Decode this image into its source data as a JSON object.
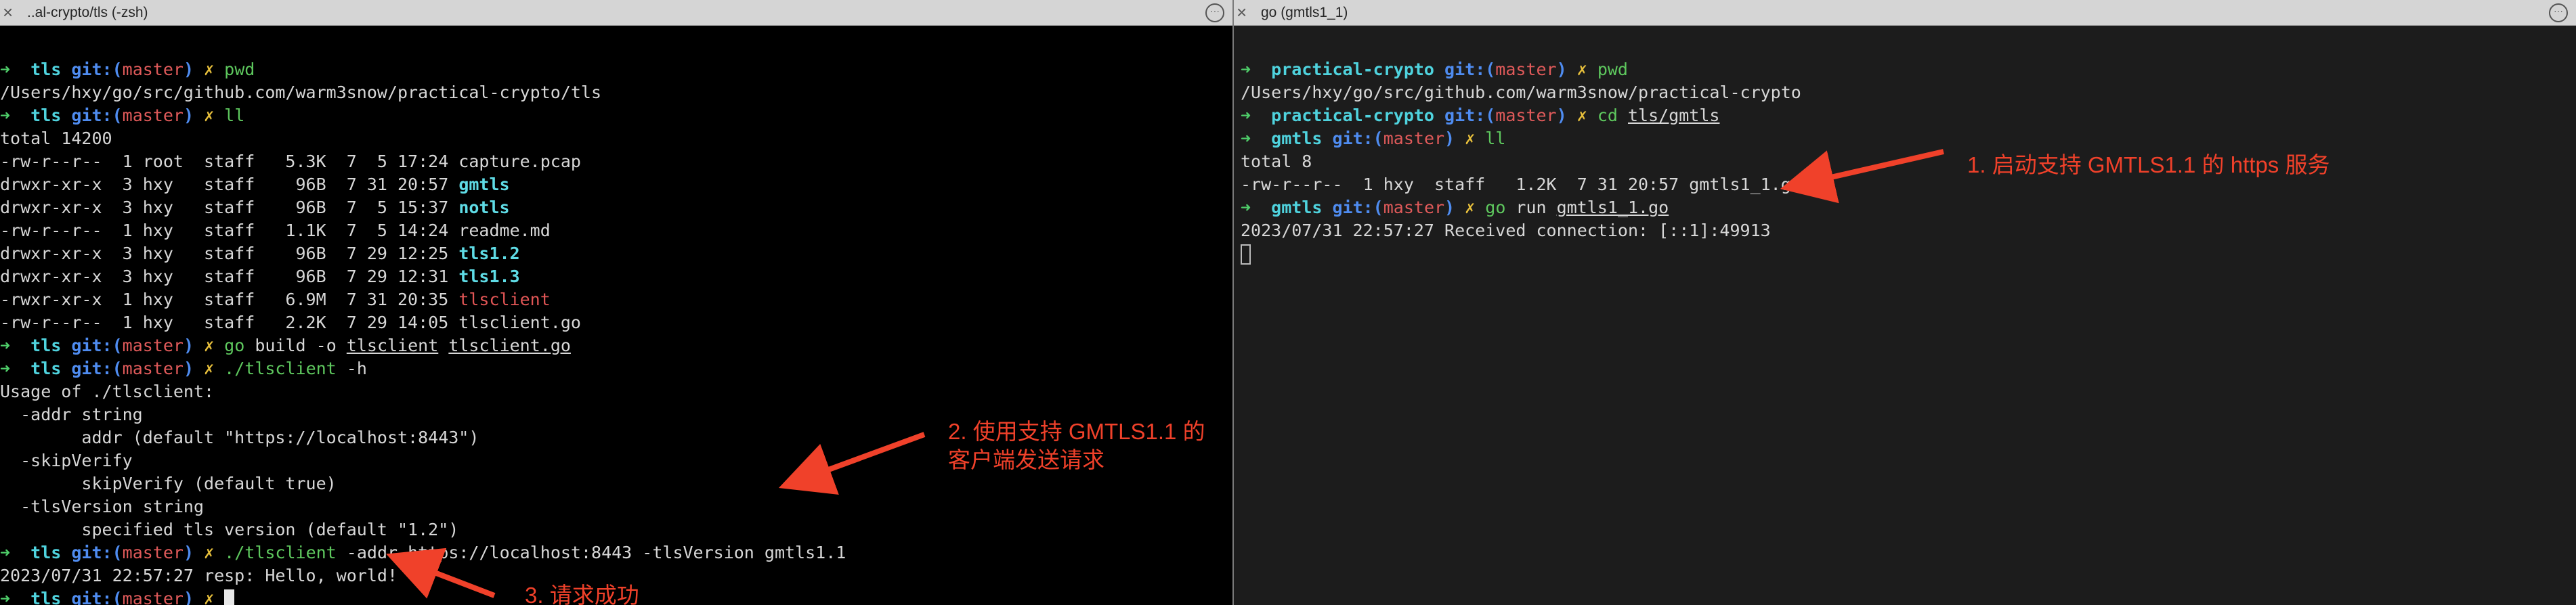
{
  "left_pane": {
    "title": "..al-crypto/tls (-zsh)",
    "lines": [
      [
        {
          "t": "➜ ",
          "c": "arr"
        },
        {
          "t": " tls",
          "c": "dir"
        },
        {
          "t": " git:(",
          "c": "git"
        },
        {
          "t": "master",
          "c": "br"
        },
        {
          "t": ")",
          "c": "git"
        },
        {
          "t": " ✗ ",
          "c": "mark"
        },
        {
          "t": "pwd",
          "c": "cmd"
        }
      ],
      [
        {
          "t": "/Users/hxy/go/src/github.com/warm3snow/practical-crypto/tls",
          "c": ""
        }
      ],
      [
        {
          "t": "➜ ",
          "c": "arr"
        },
        {
          "t": " tls",
          "c": "dir"
        },
        {
          "t": " git:(",
          "c": "git"
        },
        {
          "t": "master",
          "c": "br"
        },
        {
          "t": ")",
          "c": "git"
        },
        {
          "t": " ✗ ",
          "c": "mark"
        },
        {
          "t": "ll",
          "c": "cmd"
        }
      ],
      [
        {
          "t": "total 14200",
          "c": ""
        }
      ],
      [
        {
          "t": "-rw-r--r--  1 root  staff   5.3K  7  5 17:24 capture.pcap",
          "c": ""
        }
      ],
      [
        {
          "t": "drwxr-xr-x  3 hxy   staff    96B  7 31 20:57 ",
          "c": ""
        },
        {
          "t": "gmtls",
          "c": "bold-cyan"
        }
      ],
      [
        {
          "t": "drwxr-xr-x  3 hxy   staff    96B  7  5 15:37 ",
          "c": ""
        },
        {
          "t": "notls",
          "c": "bold-cyan"
        }
      ],
      [
        {
          "t": "-rw-r--r--  1 hxy   staff   1.1K  7  5 14:24 readme.md",
          "c": ""
        }
      ],
      [
        {
          "t": "drwxr-xr-x  3 hxy   staff    96B  7 29 12:25 ",
          "c": ""
        },
        {
          "t": "tls1.2",
          "c": "bold-cyan"
        }
      ],
      [
        {
          "t": "drwxr-xr-x  3 hxy   staff    96B  7 29 12:31 ",
          "c": ""
        },
        {
          "t": "tls1.3",
          "c": "bold-cyan"
        }
      ],
      [
        {
          "t": "-rwxr-xr-x  1 hxy   staff   6.9M  7 31 20:35 ",
          "c": ""
        },
        {
          "t": "tlsclient",
          "c": "red"
        }
      ],
      [
        {
          "t": "-rw-r--r--  1 hxy   staff   2.2K  7 29 14:05 tlsclient.go",
          "c": ""
        }
      ],
      [
        {
          "t": "➜ ",
          "c": "arr"
        },
        {
          "t": " tls",
          "c": "dir"
        },
        {
          "t": " git:(",
          "c": "git"
        },
        {
          "t": "master",
          "c": "br"
        },
        {
          "t": ")",
          "c": "git"
        },
        {
          "t": " ✗ ",
          "c": "mark"
        },
        {
          "t": "go",
          "c": "cmd"
        },
        {
          "t": " build -o ",
          "c": ""
        },
        {
          "t": "tlsclient",
          "c": "ul"
        },
        {
          "t": " ",
          "c": ""
        },
        {
          "t": "tlsclient.go",
          "c": "ul"
        }
      ],
      [
        {
          "t": "➜ ",
          "c": "arr"
        },
        {
          "t": " tls",
          "c": "dir"
        },
        {
          "t": " git:(",
          "c": "git"
        },
        {
          "t": "master",
          "c": "br"
        },
        {
          "t": ")",
          "c": "git"
        },
        {
          "t": " ✗ ",
          "c": "mark"
        },
        {
          "t": "./tlsclient",
          "c": "cmd"
        },
        {
          "t": " -h",
          "c": ""
        }
      ],
      [
        {
          "t": "Usage of ./tlsclient:",
          "c": ""
        }
      ],
      [
        {
          "t": "  -addr string",
          "c": ""
        }
      ],
      [
        {
          "t": "        addr (default \"https://localhost:8443\")",
          "c": ""
        }
      ],
      [
        {
          "t": "  -skipVerify",
          "c": ""
        }
      ],
      [
        {
          "t": "        skipVerify (default true)",
          "c": ""
        }
      ],
      [
        {
          "t": "  -tlsVersion string",
          "c": ""
        }
      ],
      [
        {
          "t": "        specified tls version (default \"1.2\")",
          "c": ""
        }
      ],
      [
        {
          "t": "➜ ",
          "c": "arr"
        },
        {
          "t": " tls",
          "c": "dir"
        },
        {
          "t": " git:(",
          "c": "git"
        },
        {
          "t": "master",
          "c": "br"
        },
        {
          "t": ")",
          "c": "git"
        },
        {
          "t": " ✗ ",
          "c": "mark"
        },
        {
          "t": "./tlsclient",
          "c": "cmd"
        },
        {
          "t": " -addr https://localhost:8443 -tlsVersion gmtls1.1",
          "c": ""
        }
      ],
      [
        {
          "t": "2023/07/31 22:57:27 resp: Hello, world!",
          "c": ""
        }
      ],
      [
        {
          "t": "➜ ",
          "c": "arr"
        },
        {
          "t": " tls",
          "c": "dir"
        },
        {
          "t": " git:(",
          "c": "git"
        },
        {
          "t": "master",
          "c": "br"
        },
        {
          "t": ")",
          "c": "git"
        },
        {
          "t": " ✗ ",
          "c": "mark"
        }
      ]
    ]
  },
  "right_pane": {
    "title": "go (gmtls1_1)",
    "lines": [
      [
        {
          "t": "➜ ",
          "c": "arr"
        },
        {
          "t": " practical-crypto",
          "c": "dir"
        },
        {
          "t": " git:(",
          "c": "git"
        },
        {
          "t": "master",
          "c": "br"
        },
        {
          "t": ")",
          "c": "git"
        },
        {
          "t": " ✗ ",
          "c": "mark"
        },
        {
          "t": "pwd",
          "c": "cmd"
        }
      ],
      [
        {
          "t": "/Users/hxy/go/src/github.com/warm3snow/practical-crypto",
          "c": ""
        }
      ],
      [
        {
          "t": "➜ ",
          "c": "arr"
        },
        {
          "t": " practical-crypto",
          "c": "dir"
        },
        {
          "t": " git:(",
          "c": "git"
        },
        {
          "t": "master",
          "c": "br"
        },
        {
          "t": ")",
          "c": "git"
        },
        {
          "t": " ✗ ",
          "c": "mark"
        },
        {
          "t": "cd",
          "c": "cmd"
        },
        {
          "t": " ",
          "c": ""
        },
        {
          "t": "tls/gmtls",
          "c": "ul"
        }
      ],
      [
        {
          "t": "➜ ",
          "c": "arr"
        },
        {
          "t": " gmtls",
          "c": "dir"
        },
        {
          "t": " git:(",
          "c": "git"
        },
        {
          "t": "master",
          "c": "br"
        },
        {
          "t": ")",
          "c": "git"
        },
        {
          "t": " ✗ ",
          "c": "mark"
        },
        {
          "t": "ll",
          "c": "cmd"
        }
      ],
      [
        {
          "t": "total 8",
          "c": ""
        }
      ],
      [
        {
          "t": "-rw-r--r--  1 hxy  staff   1.2K  7 31 20:57 gmtls1_1.go",
          "c": ""
        }
      ],
      [
        {
          "t": "➜ ",
          "c": "arr"
        },
        {
          "t": " gmtls",
          "c": "dir"
        },
        {
          "t": " git:(",
          "c": "git"
        },
        {
          "t": "master",
          "c": "br"
        },
        {
          "t": ")",
          "c": "git"
        },
        {
          "t": " ✗ ",
          "c": "mark"
        },
        {
          "t": "go",
          "c": "cmd"
        },
        {
          "t": " run ",
          "c": ""
        },
        {
          "t": "gmtls1_1.go",
          "c": "ul"
        }
      ],
      [
        {
          "t": "2023/07/31 22:57:27 Received connection: [::1]:49913",
          "c": ""
        }
      ]
    ]
  },
  "annotations": {
    "right": "1. 启动支持 GMTLS1.1 的 https 服务",
    "middle_line1": "2.  使用支持 GMTLS1.1 的",
    "middle_line2": "客户端发送请求",
    "bottom": "3.  请求成功"
  },
  "colors": {
    "arrow": "#f0412a",
    "prompt_arrow": "#4fcf6a",
    "directory": "#4fd3de",
    "git_label": "#4f8cf0",
    "branch": "#e05a5a",
    "dirty_mark": "#e8c03c",
    "command": "#5ec85e"
  },
  "icons": {
    "tab_close": "close-icon",
    "tab_more": "ellipsis-icon"
  }
}
